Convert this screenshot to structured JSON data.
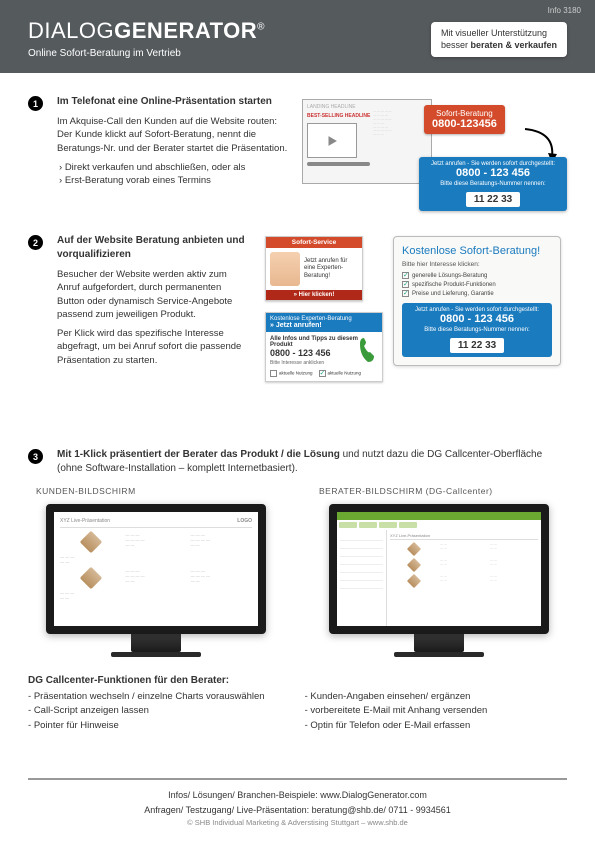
{
  "header": {
    "info_tag": "Info 3180",
    "brand_light": "DIALOG",
    "brand_bold": "GENERATOR",
    "brand_reg": "®",
    "subtitle": "Online Sofort-Beratung im Vertrieb",
    "badge_l1": "Mit visueller Unterstützung",
    "badge_l2": "besser beraten & verkaufen"
  },
  "s1": {
    "num": "1",
    "title": "Im Telefonat eine Online-Präsentation starten",
    "p1": "Im Akquise-Call den Kunden auf die Website routen: Der Kunde klickt auf Sofort-Beratung, nennt die Beratungs-Nr. und der Berater startet die Präsentation.",
    "b1": "Direkt verkaufen und abschließen, oder als",
    "b2": "Erst-Beratung vorab eines Termins",
    "vid_hl": "BEST-SELLING HEADLINE",
    "btn_t": "Sofort-Beratung",
    "btn_ph": "0800-123456",
    "box_l1": "Jetzt anrufen - Sie werden sofort durchgestellt:",
    "box_ph": "0800 - 123 456",
    "box_l2": "Bitte diese Beratungs-Nummer nennen:",
    "box_code": "11 22 33"
  },
  "s2": {
    "num": "2",
    "title": "Auf der Website Beratung anbieten und vorqualifizieren",
    "p1": "Besucher der Website werden aktiv zum Anruf aufgefordert, durch permanenten Button oder dynamisch Service-Angebote passend zum jeweiligen Produkt.",
    "p2": "Per Klick wird das spezifische Interesse abgefragt, um bei Anruf sofort die passende Präsentation zu starten.",
    "w1_hdr": "Sofort-Service",
    "w1_txt": "Jetzt anrufen für eine Experten-Beratung!",
    "w1_cta": "» Hier klicken!",
    "w2_l1": "Kostenlose Experten-Beratung",
    "w2_l2": "» Jetzt anrufen!",
    "w2_t1": "Alle Infos und Tipps zu diesem Produkt",
    "w2_ph": "0800 - 123 456",
    "w2_sm": "Bitte Interesse anklicken",
    "w2_c1": "aktuelle Nutzung",
    "w2_c2": "aktuelle Nutzung",
    "panel_title": "Kostenlose Sofort-Beratung!",
    "panel_sub": "Bitte hier Interesse klicken:",
    "opt1": "generelle Lösungs-Beratung",
    "opt2": "spezifische Produkt-Funktionen",
    "opt3": "Preise und Lieferung, Garantie",
    "pbox_l1": "Jetzt anrufen - Sie werden sofort durchgestellt:",
    "pbox_ph": "0800 - 123 456",
    "pbox_l2": "Bitte diese Beratungs-Nummer nennen:",
    "pbox_code": "11 22 33"
  },
  "s3": {
    "num": "3",
    "title_bold": "Mit 1-Klick präsentiert der Berater das Produkt / die Lösung",
    "title_rest": " und nutzt dazu die DG Callcenter-Oberfläche (ohne Software-Installation  – komplett Internetbasiert).",
    "mon1_label": "KUNDEN-BILDSCHIRM",
    "mon2_label": "BERATER-BILDSCHIRM (DG-Callcenter)",
    "k_title": "XYZ Live-Präsentation",
    "k_logo": "LOGO",
    "b_title": "XYZ Live-Präsentation",
    "funcs_title": "DG Callcenter-Funktionen für den Berater:",
    "f1": "Präsentation wechseln / einzelne Charts vorauswählen",
    "f2": "Call-Script anzeigen lassen",
    "f3": "Pointer für Hinweise",
    "f4": "Kunden-Angaben einsehen/ ergänzen",
    "f5": "vorbereitete E-Mail mit Anhang versenden",
    "f6": "Optin für Telefon oder E-Mail erfassen"
  },
  "footer": {
    "l1": "Infos/ Lösungen/ Branchen-Beispiele: www.DialogGenerator.com",
    "l2": "Anfragen/ Testzugang/ Live-Präsentation: beratung@shb.de/ 0711 - 9934561",
    "l3": "© SHB Individual Marketing & Adverstising Stuttgart – www.shb.de"
  }
}
